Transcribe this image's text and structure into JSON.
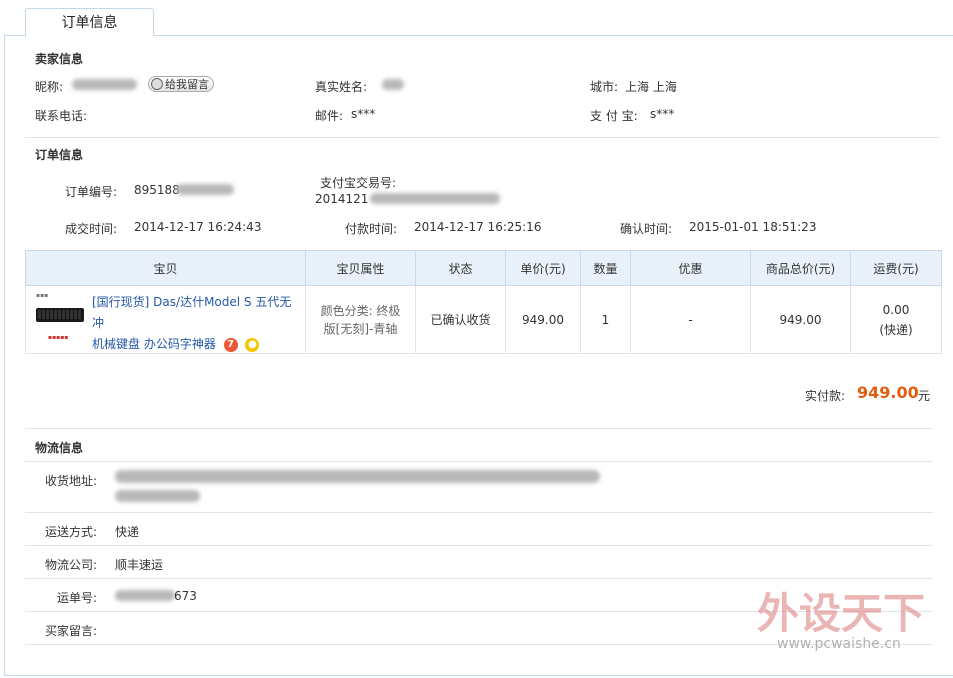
{
  "tab_title": "订单信息",
  "seller": {
    "title": "卖家信息",
    "nickname_label": "昵称:",
    "message_button": "给我留言",
    "realname_label": "真实姓名:",
    "city_label": "城市:",
    "city_value": "上海 上海",
    "phone_label": "联系电话:",
    "email_label": "邮件:",
    "email_value": "s***",
    "alipay_label": "支 付 宝:",
    "alipay_value": "s***"
  },
  "order": {
    "title": "订单信息",
    "order_no_label": "订单编号:",
    "order_no_value": "895188",
    "alipay_trade_label": "支付宝交易号:",
    "alipay_trade_value": "2014121",
    "deal_time_label": "成交时间:",
    "deal_time_value": "2014-12-17 16:24:43",
    "pay_time_label": "付款时间:",
    "pay_time_value": "2014-12-17 16:25:16",
    "confirm_time_label": "确认时间:",
    "confirm_time_value": "2015-01-01 18:51:23"
  },
  "table": {
    "headers": [
      "宝贝",
      "宝贝属性",
      "状态",
      "单价(元)",
      "数量",
      "优惠",
      "商品总价(元)",
      "运费(元)"
    ],
    "row": {
      "product_line1": "[国行现货] Das/达什Model S 五代无冲",
      "product_line2": "机械键盘 办公码字神器",
      "attr_line1": "颜色分类: 终极",
      "attr_line2": "版[无刻]-青轴",
      "status": "已确认收货",
      "unit_price": "949.00",
      "quantity": "1",
      "discount": "-",
      "total": "949.00",
      "shipping": "0.00",
      "shipping_type": "(快递)"
    }
  },
  "payment": {
    "label": "实付款:",
    "value": "949.00",
    "unit": "元"
  },
  "logistics": {
    "title": "物流信息",
    "address_label": "收货地址:",
    "method_label": "运送方式:",
    "method_value": "快递",
    "company_label": "物流公司:",
    "company_value": "顺丰速运",
    "tracking_label": "运单号:",
    "tracking_value": "673",
    "buyer_msg_label": "买家留言:"
  },
  "watermark": {
    "text": "外设天下",
    "url": "www.pcwaishe.cn"
  },
  "colors": {
    "accent_orange": "#e35c10",
    "link_blue": "#2458a8",
    "header_bg": "#e8f1fa",
    "border": "#c5d7ea"
  }
}
